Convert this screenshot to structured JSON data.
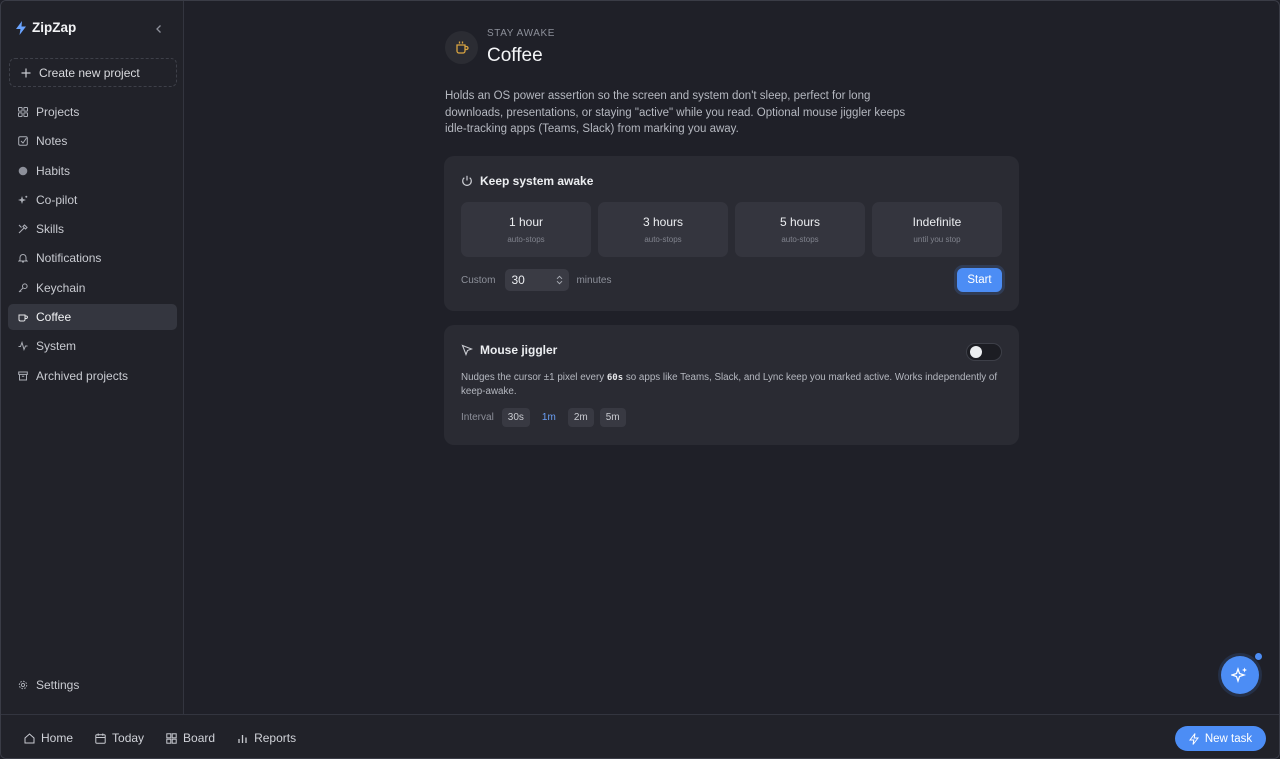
{
  "app": {
    "name": "ZipZap"
  },
  "sidebar": {
    "create_label": "Create new project",
    "items": [
      {
        "label": "Projects",
        "icon": "grid-icon"
      },
      {
        "label": "Notes",
        "icon": "note-icon"
      },
      {
        "label": "Habits",
        "icon": "circle-icon"
      },
      {
        "label": "Co-pilot",
        "icon": "sparkles-icon"
      },
      {
        "label": "Skills",
        "icon": "tools-icon"
      },
      {
        "label": "Notifications",
        "icon": "bell-icon"
      },
      {
        "label": "Keychain",
        "icon": "key-icon"
      },
      {
        "label": "Coffee",
        "icon": "cup-icon"
      },
      {
        "label": "System",
        "icon": "activity-icon"
      },
      {
        "label": "Archived projects",
        "icon": "archive-icon"
      }
    ],
    "active": "Coffee",
    "settings_label": "Settings"
  },
  "page": {
    "overline": "STAY AWAKE",
    "title": "Coffee",
    "description": "Holds an OS power assertion so the screen and system don't sleep, perfect for long downloads, presentations, or staying \"active\" while you read. Optional mouse jiggler keeps idle-tracking apps (Teams, Slack) from marking you away."
  },
  "keep_awake": {
    "title": "Keep system awake",
    "durations": [
      {
        "label": "1 hour",
        "sub": "auto-stops"
      },
      {
        "label": "3 hours",
        "sub": "auto-stops"
      },
      {
        "label": "5 hours",
        "sub": "auto-stops"
      },
      {
        "label": "Indefinite",
        "sub": "until you stop"
      }
    ],
    "custom_label": "Custom",
    "custom_value": "30",
    "custom_unit": "minutes",
    "start_label": "Start"
  },
  "jiggler": {
    "title": "Mouse jiggler",
    "enabled": false,
    "desc_before": "Nudges the cursor ±1 pixel every ",
    "desc_code": "60s",
    "desc_after": " so apps like Teams, Slack, and Lync keep you marked active. Works independently of keep-awake.",
    "interval_label": "Interval",
    "intervals": [
      "30s",
      "1m",
      "2m",
      "5m"
    ],
    "selected_interval": "1m"
  },
  "bottom": {
    "items": [
      {
        "label": "Home",
        "icon": "home-icon"
      },
      {
        "label": "Today",
        "icon": "calendar-icon"
      },
      {
        "label": "Board",
        "icon": "board-icon"
      },
      {
        "label": "Reports",
        "icon": "bar-chart-icon"
      }
    ],
    "new_task_label": "New task"
  },
  "colors": {
    "accent": "#4c8df5",
    "background": "#1f2028",
    "card": "#2a2b33"
  }
}
